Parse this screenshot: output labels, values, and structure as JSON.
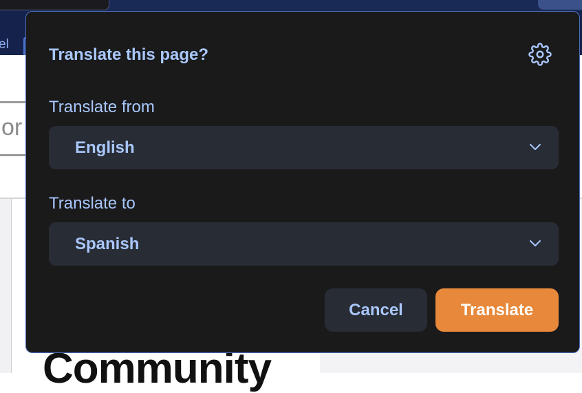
{
  "background": {
    "toolbar_partial_text": "el",
    "search_partial_text": "or",
    "heading_partial_text": "Community"
  },
  "popup": {
    "title": "Translate this page?",
    "settings_icon": "gear-icon",
    "from": {
      "label": "Translate from",
      "selected": "English"
    },
    "to": {
      "label": "Translate to",
      "selected": "Spanish"
    },
    "cancel_label": "Cancel",
    "translate_label": "Translate"
  },
  "colors": {
    "accent_text": "#a9c7fb",
    "primary_button": "#e7883a",
    "popup_background": "#1a1a1b",
    "select_background": "#282c35"
  }
}
